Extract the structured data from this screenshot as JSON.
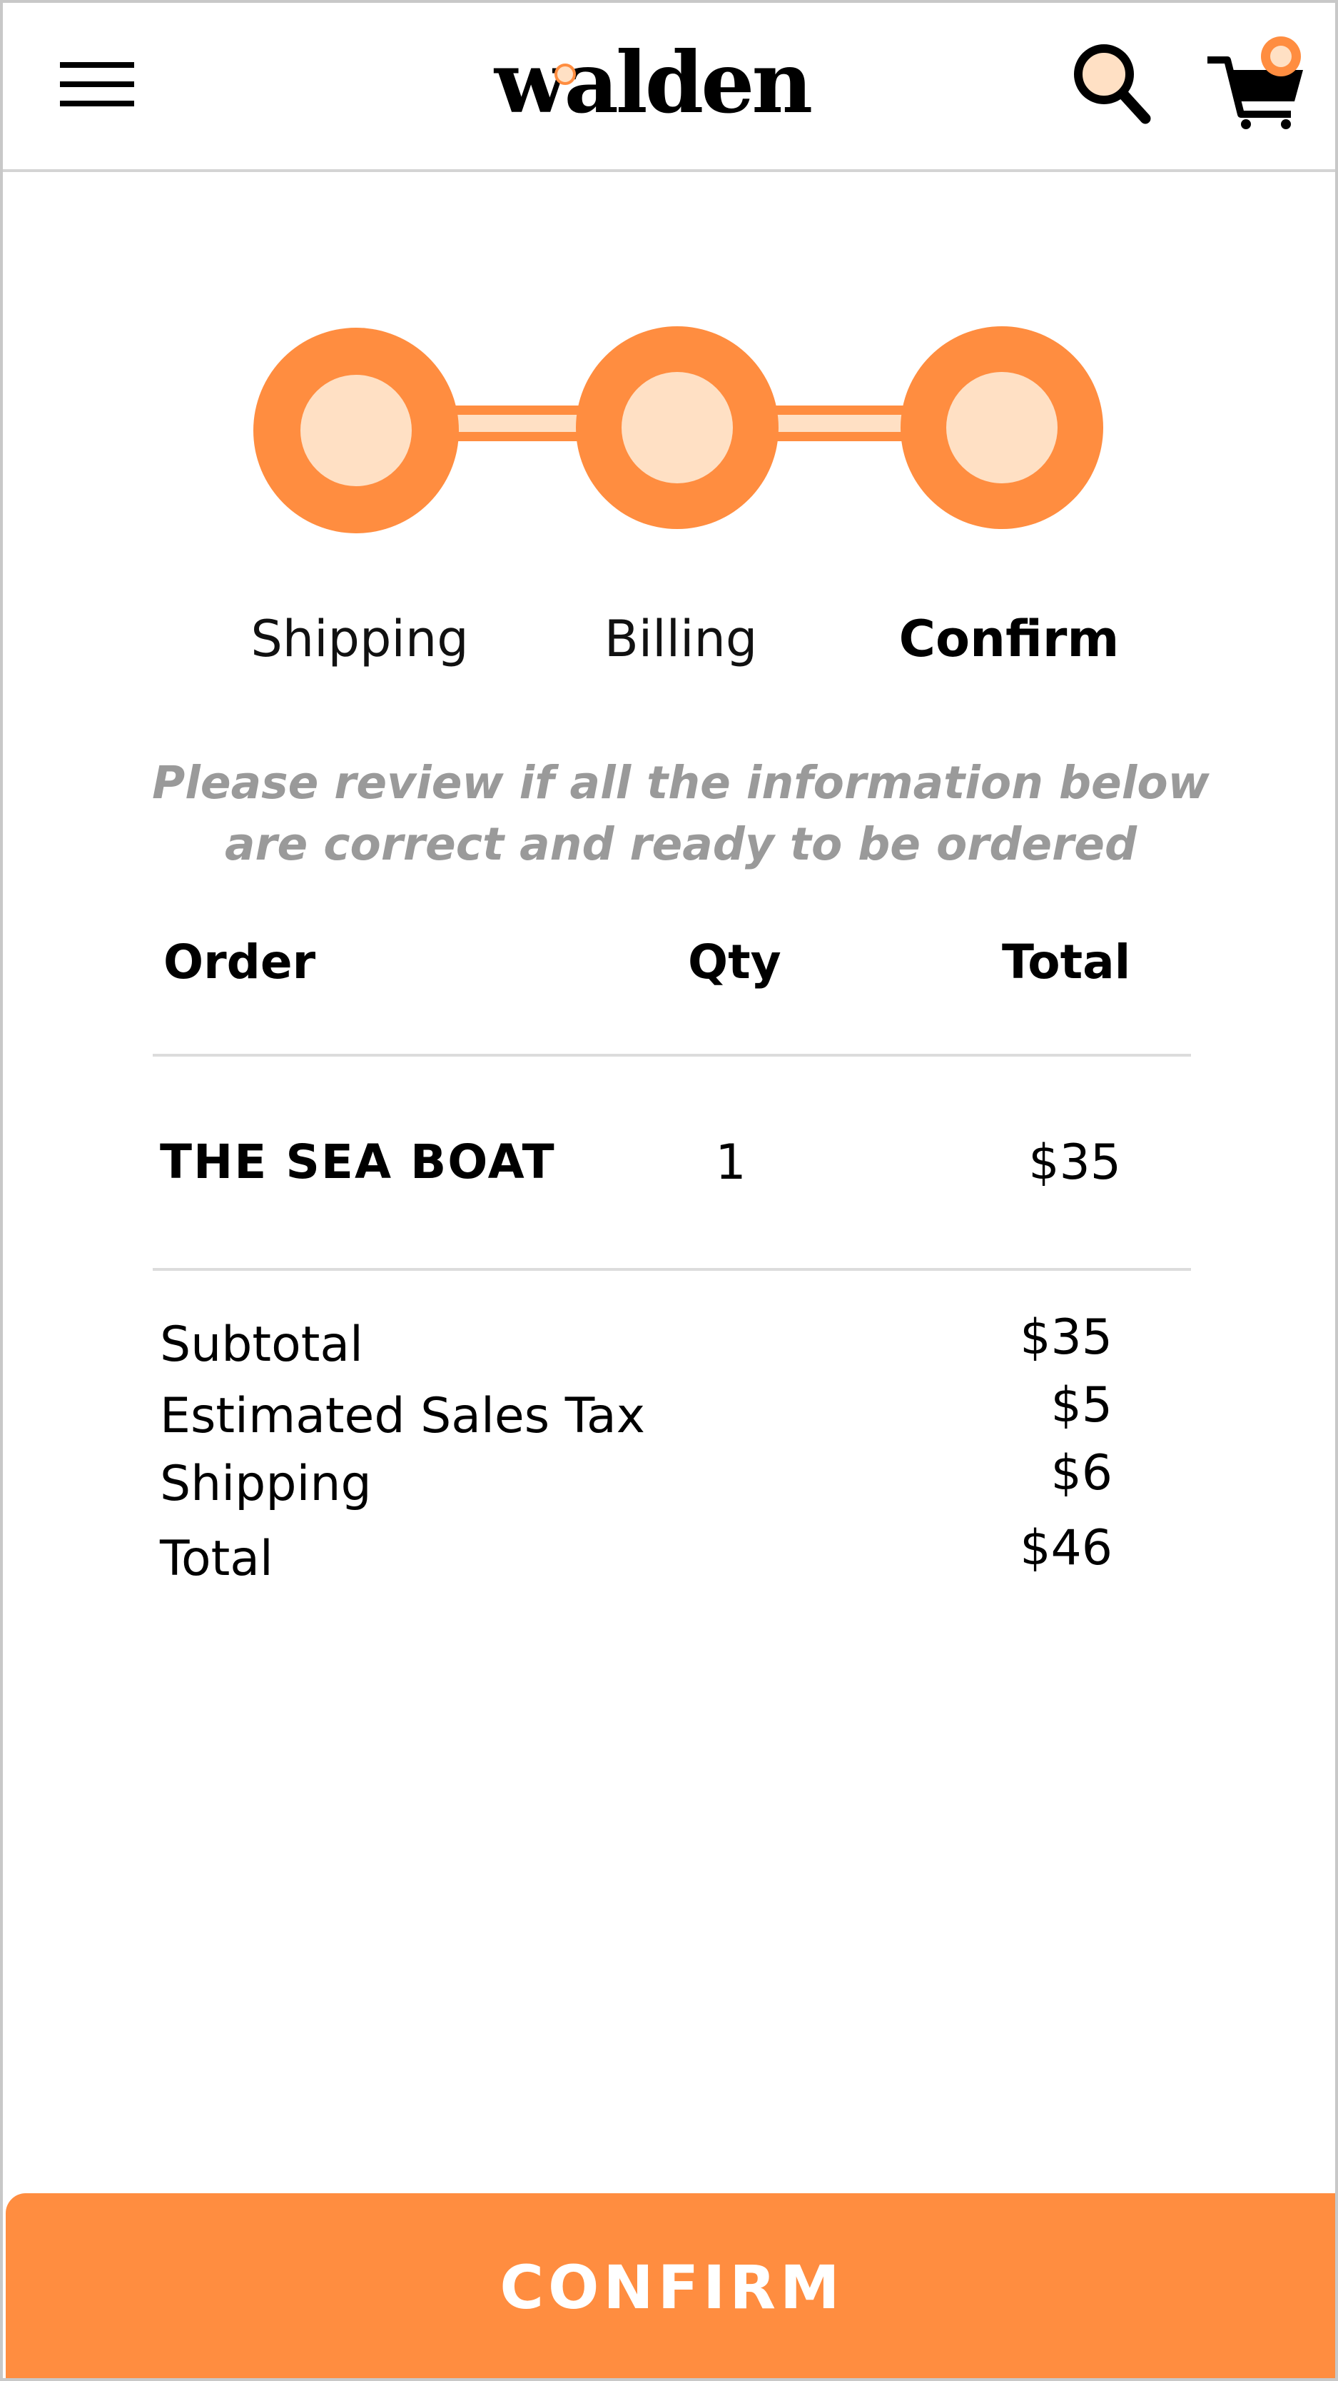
{
  "header": {
    "logo_text": "walden",
    "menu_icon": "hamburger-menu-icon",
    "search_icon": "search-icon",
    "cart_icon": "cart-icon"
  },
  "stepper": {
    "steps": [
      {
        "label": "Shipping",
        "state": "complete"
      },
      {
        "label": "Billing",
        "state": "complete"
      },
      {
        "label": "Confirm",
        "state": "active"
      }
    ]
  },
  "notice": {
    "line1": "Please review if all the information below",
    "line2": "are correct and ready to be ordered"
  },
  "order": {
    "columns": [
      "Order",
      "Qty",
      "Total"
    ],
    "items": [
      {
        "name": "THE SEA BOAT",
        "qty": "1",
        "total": "$35"
      }
    ]
  },
  "summary": [
    {
      "label": "Subtotal",
      "value": "$35"
    },
    {
      "label": "Estimated Sales Tax",
      "value": "$5"
    },
    {
      "label": "Shipping",
      "value": "$6"
    },
    {
      "label": "Total",
      "value": "$46"
    }
  ],
  "actions": {
    "confirm_label": "CONFIRM"
  },
  "colors": {
    "accent": "#ff8d40",
    "accent_light": "#ffe0c4",
    "muted_text": "#9a9a9a",
    "divider": "#dcdcdc"
  }
}
